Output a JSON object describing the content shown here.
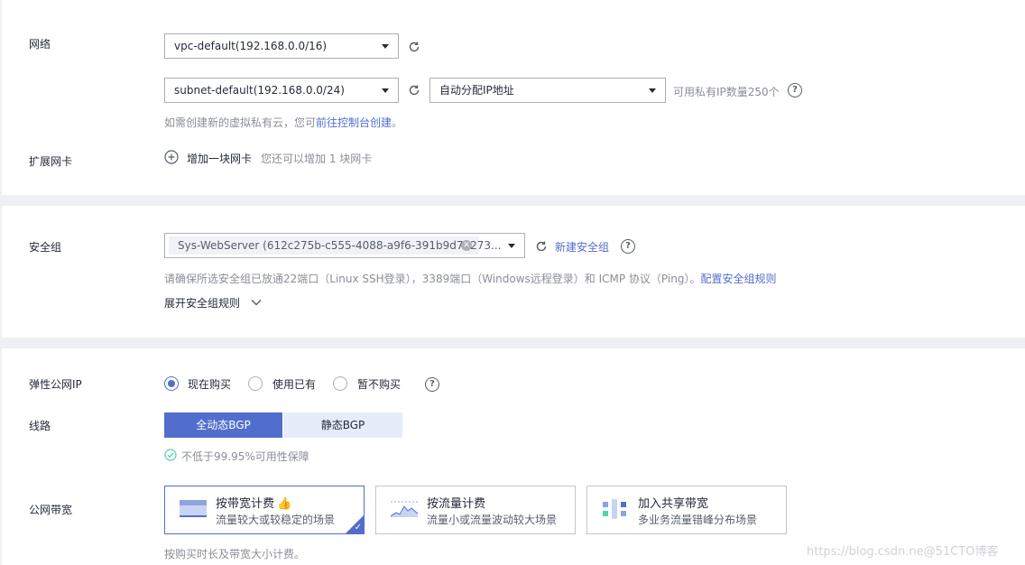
{
  "network": {
    "label": "网络",
    "vpc_value": "vpc-default(192.168.0.0/16)",
    "subnet_value": "subnet-default(192.168.0.0/24)",
    "ip_mode_value": "自动分配IP地址",
    "available_ips": "可用私有IP数量250个",
    "hint_prefix": "如需创建新的虚拟私有云，您可",
    "hint_link": "前往控制台创建",
    "hint_suffix": "。"
  },
  "ext_nic": {
    "label": "扩展网卡",
    "add_label": "增加一块网卡",
    "hint": "您还可以增加 1 块网卡"
  },
  "security_group": {
    "label": "安全组",
    "value": "Sys-WebServer (612c275b-c555-4088-a9f6-391b9d70273...",
    "create_link": "新建安全组",
    "hint": "请确保所选安全组已放通22端口（Linux SSH登录），3389端口（Windows远程登录）和 ICMP 协议（Ping）。",
    "config_link": "配置安全组规则",
    "expand_label": "展开安全组规则"
  },
  "eip": {
    "label": "弹性公网IP",
    "options": [
      "现在购买",
      "使用已有",
      "暂不购买"
    ],
    "selected_index": 0
  },
  "line": {
    "label": "线路",
    "options": [
      "全动态BGP",
      "静态BGP"
    ],
    "selected_index": 0,
    "availability": "不低于99.95%可用性保障"
  },
  "bandwidth": {
    "label": "公网带宽",
    "cards": [
      {
        "title": "按带宽计费",
        "desc": "流量较大或较稳定的场景"
      },
      {
        "title": "按流量计费",
        "desc": "流量小或流量波动较大场景"
      },
      {
        "title": "加入共享带宽",
        "desc": "多业务流量错峰分布场景"
      }
    ],
    "selected_index": 0,
    "footer_hint": "按购买时长及带宽大小计费。"
  },
  "watermark": "https://blog.csdn.ne@51CTO博客",
  "colors": {
    "accent": "#526ecc",
    "page_bg": "#eef0f5",
    "success": "#50d4ab"
  }
}
